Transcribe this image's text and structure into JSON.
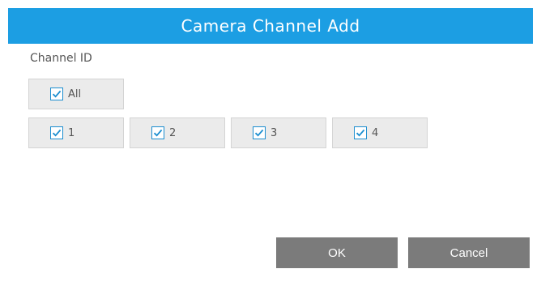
{
  "dialog": {
    "title": "Camera Channel Add",
    "channel_label": "Channel ID",
    "all_label": "All",
    "channels": [
      {
        "label": "1",
        "checked": true
      },
      {
        "label": "2",
        "checked": true
      },
      {
        "label": "3",
        "checked": true
      },
      {
        "label": "4",
        "checked": true
      }
    ],
    "ok_label": "OK",
    "cancel_label": "Cancel"
  },
  "colors": {
    "titlebar": "#1c9ee3",
    "button": "#7b7b7b",
    "checkbox_border": "#1c8ed0"
  },
  "icons": {
    "checkbox": "checkmark-icon"
  }
}
